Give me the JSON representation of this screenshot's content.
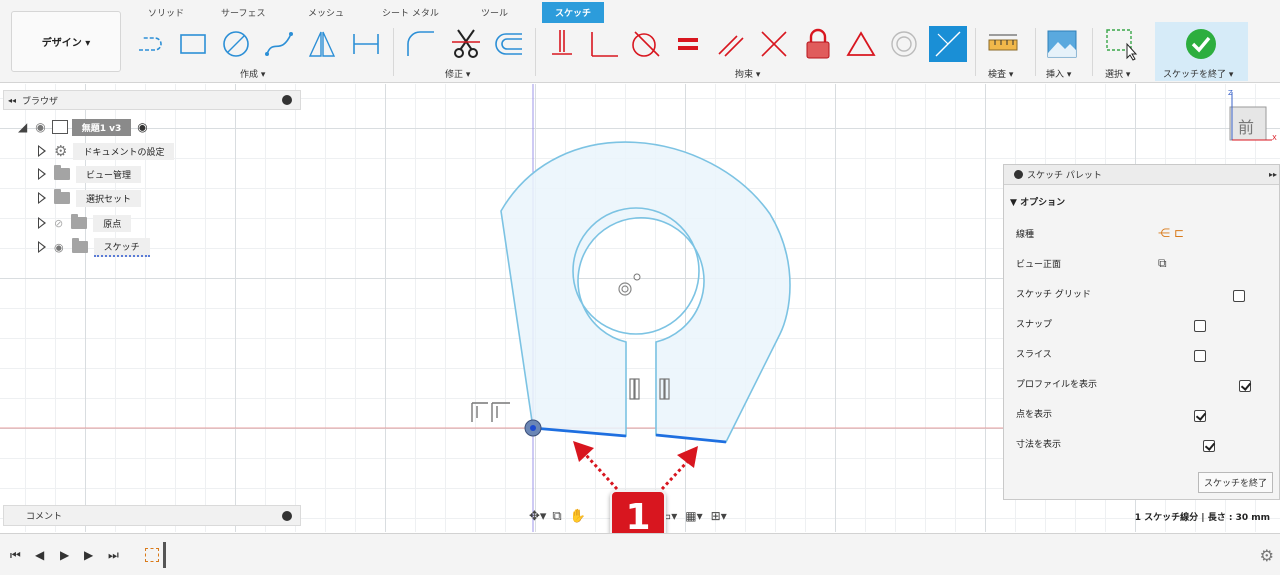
{
  "workspace": {
    "label": "デザイン ▾"
  },
  "tabs": [
    "ソリッド",
    "サーフェス",
    "メッシュ",
    "シート メタル",
    "ツール",
    "スケッチ"
  ],
  "groups": {
    "create": "作成 ▾",
    "modify": "修正 ▾",
    "constraints": "拘束 ▾",
    "inspect": "検査 ▾",
    "insert": "挿入 ▾",
    "select": "選択 ▾",
    "finish": "スケッチを終了 ▾"
  },
  "browser": {
    "title": "ブラウザ",
    "root": "無題1 v3",
    "items": [
      "ドキュメントの設定",
      "ビュー管理",
      "選択セット",
      "原点",
      "スケッチ"
    ]
  },
  "viewcube": {
    "face": "前",
    "z": "Z",
    "x": "X"
  },
  "palette": {
    "title": "スケッチ パレット",
    "section": "オプション",
    "rows": [
      {
        "label": "線種"
      },
      {
        "label": "ビュー正面"
      },
      {
        "label": "スケッチ グリッド",
        "checked": false
      },
      {
        "label": "スナップ",
        "checked": false
      },
      {
        "label": "スライス",
        "checked": false
      },
      {
        "label": "プロファイルを表示",
        "checked": true
      },
      {
        "label": "点を表示",
        "checked": true
      },
      {
        "label": "寸法を表示",
        "checked": true
      }
    ],
    "finish_button": "スケッチを終了"
  },
  "comment": {
    "label": "コメント"
  },
  "status": {
    "text": "1 スケッチ線分 | 長さ : 30 mm"
  },
  "badge": {
    "number": "1"
  },
  "colors": {
    "accent": "#2c9cdb",
    "sketch_line": "#7cc3e3",
    "selected_line": "#1e6fe0",
    "badge": "#d8161f"
  }
}
